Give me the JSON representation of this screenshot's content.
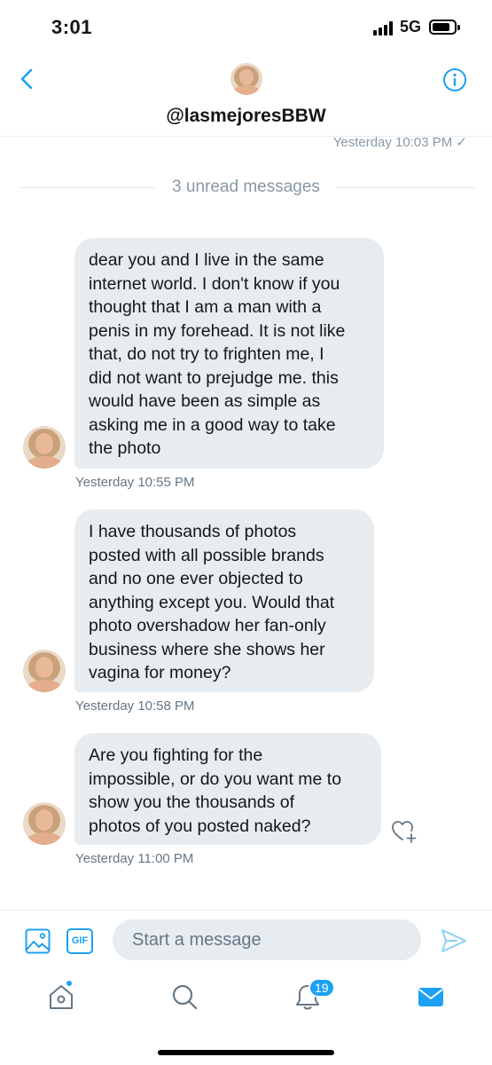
{
  "status_bar": {
    "time": "3:01",
    "network": "5G"
  },
  "header": {
    "username": "@lasmejoresBBW",
    "back_icon": "chevron-left-icon",
    "info_icon": "info-circle-icon"
  },
  "conversation": {
    "previous_timestamp": "Yesterday 10:03 PM ✓",
    "unread_divider": "3 unread messages",
    "messages": [
      {
        "text": "dear you and I live in the same\ninternet world. I don't know if you\nthought that I am a man with a\npenis in my forehead. It is not like\nthat, do not try to frighten me, I\ndid not want to prejudge me. this\nwould have been as simple as\nasking me in a good way to take\nthe photo",
        "timestamp": "Yesterday 10:55 PM"
      },
      {
        "text": "I have thousands of photos\nposted with all possible brands\nand no one ever objected to\nanything except you. Would that\nphoto overshadow her fan-only\nbusiness where she shows her\nvagina for money?",
        "timestamp": "Yesterday 10:58 PM"
      },
      {
        "text": "Are you fighting for the\nimpossible, or do you want me to\nshow you the thousands of\nphotos of you posted naked?",
        "timestamp": "Yesterday 11:00 PM"
      }
    ]
  },
  "composer": {
    "placeholder": "Start a message",
    "gif_label": "GIF"
  },
  "tab_bar": {
    "notifications_badge": "19"
  },
  "colors": {
    "accent": "#1da1f2",
    "bubble_bg": "#e6ecf0",
    "muted_text": "#657786"
  }
}
